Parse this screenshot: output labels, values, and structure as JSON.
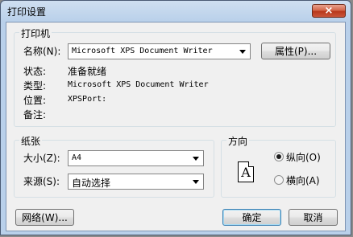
{
  "window": {
    "title": "打印设置",
    "close_symbol": "×"
  },
  "printer": {
    "group_title": "打印机",
    "name_label": "名称(N):",
    "name_value": "Microsoft XPS Document Writer",
    "properties_button": "属性(P)...",
    "status_label": "状态:",
    "status_value": "准备就绪",
    "type_label": "类型:",
    "type_value": "Microsoft XPS Document Writer",
    "where_label": "位置:",
    "where_value": "XPSPort:",
    "comment_label": "备注:",
    "comment_value": ""
  },
  "paper": {
    "group_title": "纸张",
    "size_label": "大小(Z):",
    "size_value": "A4",
    "source_label": "来源(S):",
    "source_value": "自动选择"
  },
  "orientation": {
    "group_title": "方向",
    "icon_letter": "A",
    "portrait_label": "纵向(O)",
    "landscape_label": "横向(A)",
    "selected": "portrait"
  },
  "buttons": {
    "network": "网络(W)...",
    "ok": "确定",
    "cancel": "取消"
  }
}
